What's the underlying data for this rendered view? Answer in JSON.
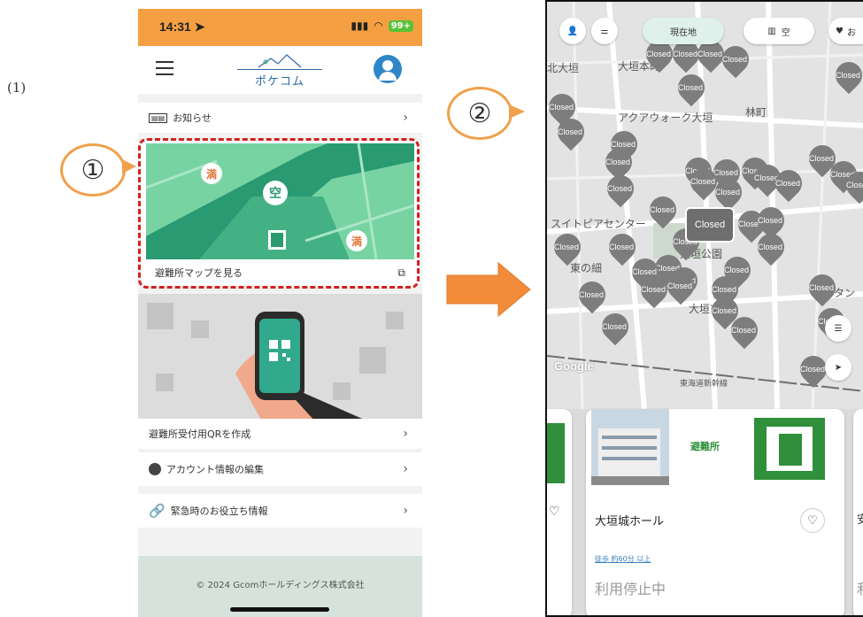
{
  "step_label": "(1)",
  "callouts": {
    "one": "①",
    "two": "②"
  },
  "colors": {
    "orange": "#f4a042",
    "dash_red": "#d42020",
    "teal": "#2aa37a",
    "pin_gray": "#7d7d7d"
  },
  "phone1": {
    "status": {
      "time": "14:31",
      "battery": "99+"
    },
    "app": {
      "logo": "ポケコム"
    },
    "notice_row": {
      "label": "お知らせ",
      "icon": "news-icon"
    },
    "map_card": {
      "caption": "避難所マップを見る",
      "pins": [
        "満",
        "空",
        "満"
      ]
    },
    "menu": [
      {
        "label": "避難所受付用QRを作成",
        "icon": ""
      },
      {
        "label": "アカウント情報の編集",
        "icon": "account-icon"
      },
      {
        "label": "緊急時のお役立ち情報",
        "icon": "link-icon"
      }
    ],
    "footer": "© 2024 Gcomホールディングス株式会社"
  },
  "phone2": {
    "filters": {
      "location": "現在地",
      "vacant": "空",
      "favorite": "お"
    },
    "pin_label": "Closed",
    "map_labels": [
      "大垣本町",
      "アクアウォーク大垣",
      "林町",
      "大垣公園",
      "大垣市民",
      "岐阜タン",
      "東海道新幹線",
      "スイトピアセンター",
      "東の細",
      "北大垣",
      "大垣城"
    ],
    "card": {
      "name": "大垣城ホール",
      "category": "避難所",
      "distance": "徒歩 約60分 以上",
      "status": "利用停止中"
    },
    "next_card": {
      "name_initial": "安",
      "status_initial": "利"
    },
    "google": "Google"
  }
}
